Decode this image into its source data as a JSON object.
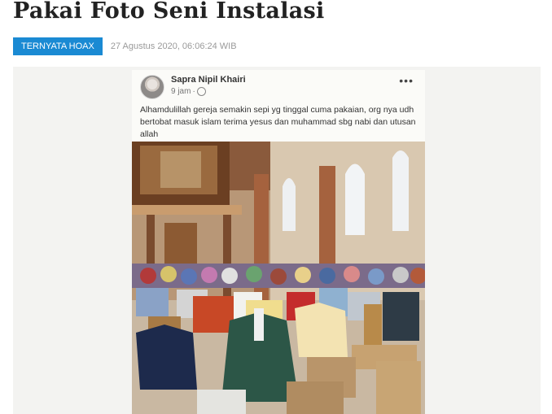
{
  "article": {
    "title": "Pakai Foto Seni Instalasi",
    "label": "TERNYATA HOAX",
    "timestamp": "27 Agustus 2020, 06:06:24 WIB"
  },
  "post": {
    "author": "Sapra Nipil Khairi",
    "time": "9 jam",
    "separator": "·",
    "more_icon": "more-horizontal-icon",
    "caption": "Alhamdulillah gereja semakin sepi yg tinggal cuma pakaian, org nya udh bertobat masuk islam terima yesus dan muhammad sbg nabi dan utusan allah"
  },
  "colors": {
    "badge": "#1a8ad3",
    "headline": "#222222",
    "date": "#9a9a9a"
  }
}
